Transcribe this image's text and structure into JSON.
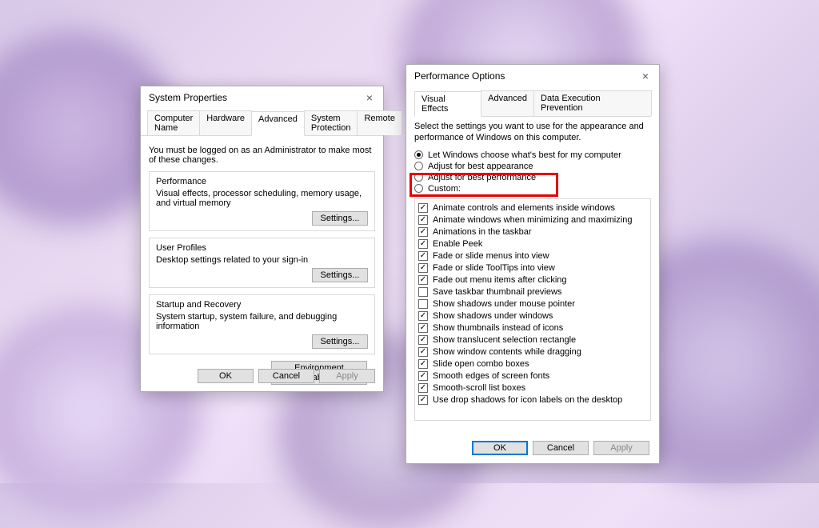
{
  "sysprop": {
    "title": "System Properties",
    "tabs": [
      "Computer Name",
      "Hardware",
      "Advanced",
      "System Protection",
      "Remote"
    ],
    "activeTab": 2,
    "note": "You must be logged on as an Administrator to make most of these changes.",
    "groups": [
      {
        "legend": "Performance",
        "desc": "Visual effects, processor scheduling, memory usage, and virtual memory",
        "button": "Settings..."
      },
      {
        "legend": "User Profiles",
        "desc": "Desktop settings related to your sign-in",
        "button": "Settings..."
      },
      {
        "legend": "Startup and Recovery",
        "desc": "System startup, system failure, and debugging information",
        "button": "Settings..."
      }
    ],
    "envVarsBtn": "Environment Variables...",
    "ok": "OK",
    "cancel": "Cancel",
    "apply": "Apply"
  },
  "perfopt": {
    "title": "Performance Options",
    "tabs": [
      "Visual Effects",
      "Advanced",
      "Data Execution Prevention"
    ],
    "activeTab": 0,
    "desc": "Select the settings you want to use for the appearance and performance of Windows on this computer.",
    "radios": [
      {
        "label": "Let Windows choose what's best for my computer",
        "selected": true
      },
      {
        "label": "Adjust for best appearance",
        "selected": false
      },
      {
        "label": "Adjust for best performance",
        "selected": false
      },
      {
        "label": "Custom:",
        "selected": false
      }
    ],
    "checks": [
      {
        "label": "Animate controls and elements inside windows",
        "checked": true
      },
      {
        "label": "Animate windows when minimizing and maximizing",
        "checked": true
      },
      {
        "label": "Animations in the taskbar",
        "checked": true
      },
      {
        "label": "Enable Peek",
        "checked": true
      },
      {
        "label": "Fade or slide menus into view",
        "checked": true
      },
      {
        "label": "Fade or slide ToolTips into view",
        "checked": true
      },
      {
        "label": "Fade out menu items after clicking",
        "checked": true
      },
      {
        "label": "Save taskbar thumbnail previews",
        "checked": false
      },
      {
        "label": "Show shadows under mouse pointer",
        "checked": false
      },
      {
        "label": "Show shadows under windows",
        "checked": true
      },
      {
        "label": "Show thumbnails instead of icons",
        "checked": true
      },
      {
        "label": "Show translucent selection rectangle",
        "checked": true
      },
      {
        "label": "Show window contents while dragging",
        "checked": true
      },
      {
        "label": "Slide open combo boxes",
        "checked": true
      },
      {
        "label": "Smooth edges of screen fonts",
        "checked": true
      },
      {
        "label": "Smooth-scroll list boxes",
        "checked": true
      },
      {
        "label": "Use drop shadows for icon labels on the desktop",
        "checked": true
      }
    ],
    "ok": "OK",
    "cancel": "Cancel",
    "apply": "Apply"
  }
}
